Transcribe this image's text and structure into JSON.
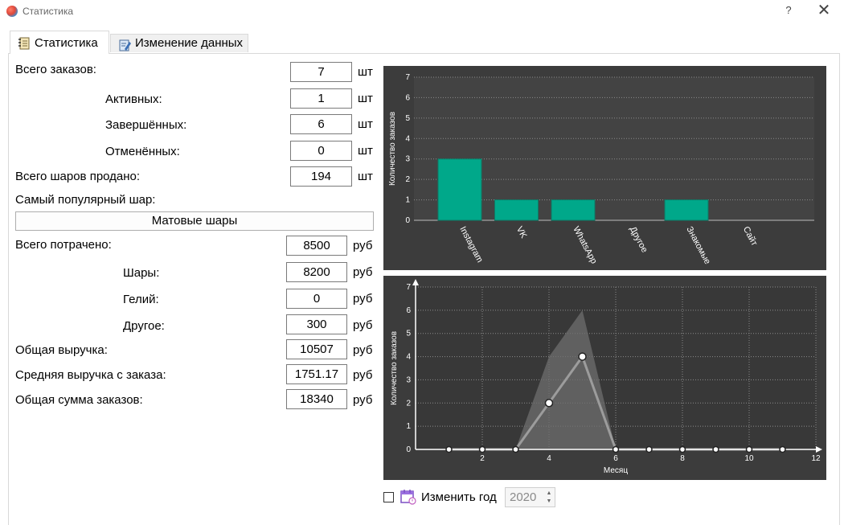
{
  "window": {
    "title": "Статистика",
    "help": "?",
    "close": "✕"
  },
  "tabs": [
    {
      "label": "Статистика",
      "active": true
    },
    {
      "label": "Изменение данных",
      "active": false
    }
  ],
  "stats": {
    "total_orders": {
      "label": "Всего заказов:",
      "value": "7",
      "unit": "шт"
    },
    "active": {
      "label": "Активных:",
      "value": "1",
      "unit": "шт"
    },
    "completed": {
      "label": "Завершённых:",
      "value": "6",
      "unit": "шт"
    },
    "cancelled": {
      "label": "Отменённых:",
      "value": "0",
      "unit": "шт"
    },
    "balloons_sold": {
      "label": "Всего шаров продано:",
      "value": "194",
      "unit": "шт"
    },
    "popular_label": "Самый популярный шар:",
    "popular_value": "Матовые шары",
    "total_spent": {
      "label": "Всего потрачено:",
      "value": "8500",
      "unit": "руб"
    },
    "spent_balloons": {
      "label": "Шары:",
      "value": "8200",
      "unit": "руб"
    },
    "spent_helium": {
      "label": "Гелий:",
      "value": "0",
      "unit": "руб"
    },
    "spent_other": {
      "label": "Другое:",
      "value": "300",
      "unit": "руб"
    },
    "total_revenue": {
      "label": "Общая выручка:",
      "value": "10507",
      "unit": "руб"
    },
    "avg_revenue": {
      "label": "Средняя выручка с заказа:",
      "value": "1751.17",
      "unit": "руб"
    },
    "total_sum": {
      "label": "Общая сумма заказов:",
      "value": "18340",
      "unit": "руб"
    }
  },
  "year_control": {
    "label": "Изменить год",
    "value": "2020",
    "checked": false
  },
  "colors": {
    "bar": "#00a88a",
    "chart_bg": "#3c3c3c",
    "plot_bg": "#434343",
    "area": "#6e6e6e",
    "line": "#9c9c9c"
  },
  "chart_data": [
    {
      "type": "bar",
      "categories": [
        "Instagram",
        "VK",
        "WhatsApp",
        "Другое",
        "Знакомые",
        "Сайт"
      ],
      "values": [
        3,
        1,
        1,
        0,
        1,
        0
      ],
      "ylabel": "Количество заказов",
      "ylim": [
        0,
        7
      ],
      "yticks": [
        0,
        1,
        2,
        3,
        4,
        5,
        6,
        7
      ],
      "grid": true
    },
    {
      "type": "line",
      "x": [
        1,
        2,
        3,
        4,
        5,
        6,
        7,
        8,
        9,
        10,
        11
      ],
      "y": [
        0,
        0,
        0,
        2,
        4,
        0,
        0,
        0,
        0,
        0,
        0
      ],
      "band_upper": [
        0,
        0,
        0,
        4,
        6,
        0,
        0,
        0,
        0,
        0,
        0
      ],
      "xlabel": "Месяц",
      "ylabel": "Количество заказов",
      "xlim": [
        0,
        12
      ],
      "ylim": [
        0,
        7
      ],
      "xticks": [
        2,
        4,
        6,
        8,
        10,
        12
      ],
      "yticks": [
        0,
        1,
        2,
        3,
        4,
        5,
        6,
        7
      ],
      "grid": true
    }
  ]
}
